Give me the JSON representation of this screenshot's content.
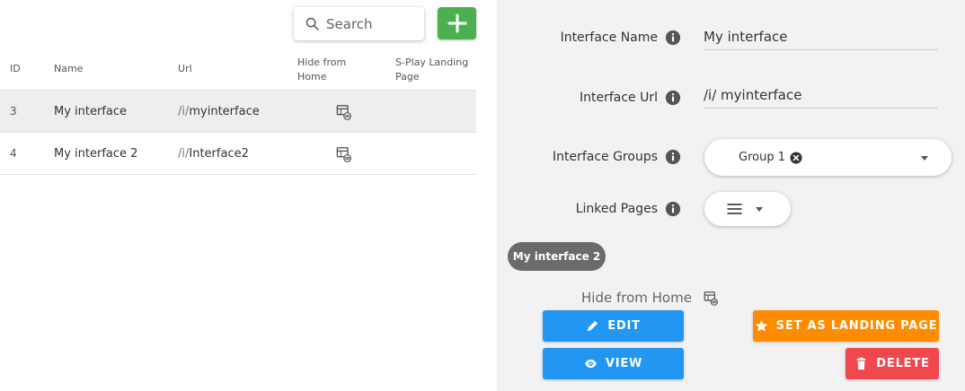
{
  "toolbar": {
    "search_placeholder": "Search"
  },
  "table": {
    "columns": {
      "id": "ID",
      "name": "Name",
      "url": "Url",
      "hide_from_home": [
        "Hide from",
        "Home"
      ],
      "landing_page": [
        "S-Play Landing",
        "Page"
      ]
    },
    "rows": [
      {
        "id": "3",
        "name": "My interface",
        "url_prefix": "/i/",
        "url_slug": "myinterface",
        "selected": true
      },
      {
        "id": "4",
        "name": "My interface 2",
        "url_prefix": "/i/",
        "url_slug": "Interface2",
        "selected": false
      }
    ]
  },
  "details": {
    "interface_name_label": "Interface Name",
    "interface_name_value": "My interface",
    "interface_url_label": "Interface Url",
    "interface_url_value": "/i/ myinterface",
    "interface_groups_label": "Interface Groups",
    "group_chip": "Group 1",
    "linked_pages_label": "Linked Pages",
    "linked_page_chip": "My interface 2",
    "hide_from_home_label": "Hide from Home",
    "buttons": {
      "edit": "EDIT",
      "view": "VIEW",
      "set_landing": "SET AS LANDING PAGE",
      "delete": "DELETE"
    }
  },
  "colors": {
    "add_green": "#4caf50",
    "primary_blue": "#2196f3",
    "landing_orange": "#ff8c00",
    "delete_red": "#f0484c",
    "panel_bg": "#f2f2f2"
  }
}
